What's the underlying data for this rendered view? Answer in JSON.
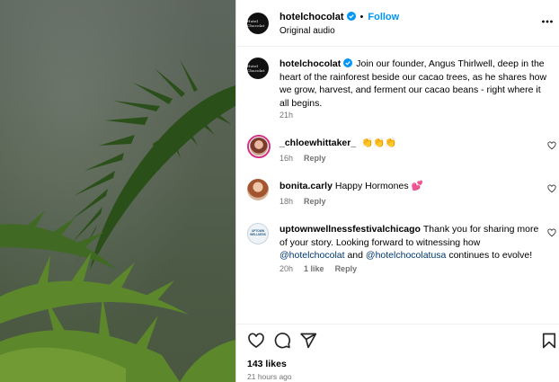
{
  "post": {
    "username": "hotelchocolat",
    "follow_label": "Follow",
    "dot": "•",
    "audio": "Original audio",
    "avatar_text": "Hotel Chocolat"
  },
  "caption": {
    "username": "hotelchocolat",
    "text": "Join our founder, Angus Thirlwell, deep in the heart of the rainforest beside our cacao trees, as he shares how we grow, harvest, and ferment our cacao beans - right where it all begins.",
    "time": "21h"
  },
  "comments": [
    {
      "username": "_chloewhittaker_",
      "text": "👏👏👏",
      "time": "16h",
      "reply": "Reply"
    },
    {
      "username": "bonita.carly",
      "text": "Happy Hormones 💕",
      "time": "18h",
      "reply": "Reply"
    },
    {
      "username": "uptownwellnessfestivalchicago",
      "text_a": "Thank you for sharing more of your story. Looking forward to witnessing how",
      "mention_1": "@hotelchocolat",
      "and": "and",
      "mention_2": "@hotelchocolatusa",
      "text_b": "continues to evolve!",
      "time": "20h",
      "likes": "1 like",
      "reply": "Reply",
      "avatar_text": "UPTOWN WELLNESS"
    }
  ],
  "footer": {
    "likes": "143 likes",
    "ago": "21 hours ago"
  },
  "icons": [
    "verified-badge-icon",
    "more-options-icon",
    "heart-icon",
    "comment-icon",
    "share-icon",
    "save-icon"
  ],
  "colors": {
    "link_blue": "#0095f6",
    "mention": "#00376b",
    "muted": "#737373",
    "verified": "#0095f6"
  }
}
